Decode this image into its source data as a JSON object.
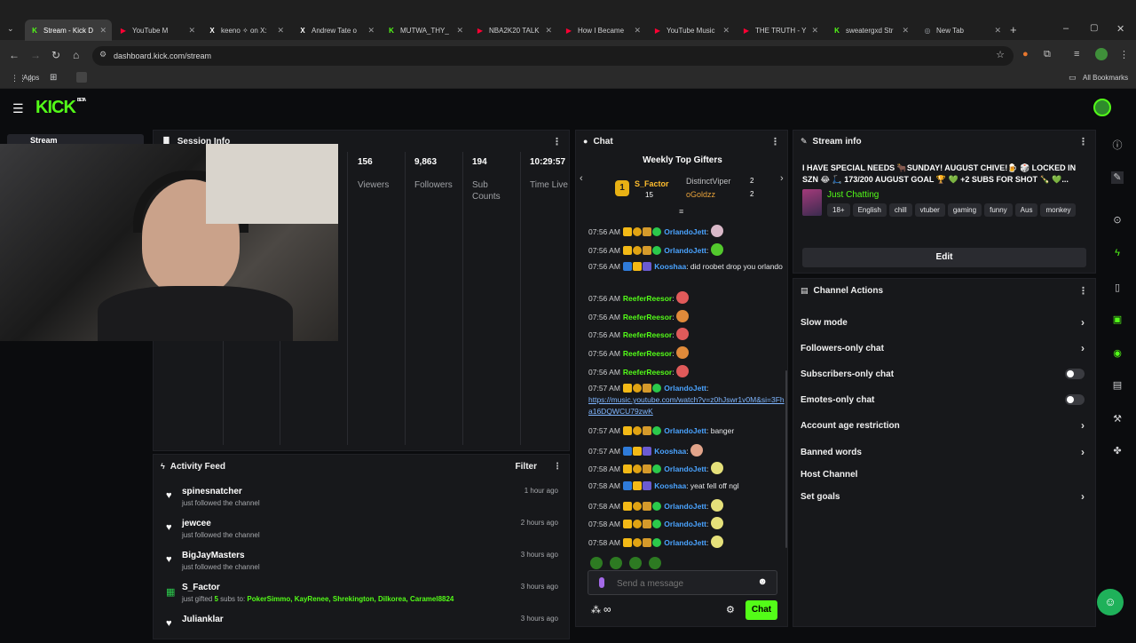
{
  "browser": {
    "tabs": [
      {
        "label": "Stream - Kick D",
        "color": "#53fc18",
        "glyph": "K"
      },
      {
        "label": "YouTube M",
        "color": "#ff0033",
        "glyph": "▶"
      },
      {
        "label": "keeno ✧ on X:",
        "color": "#ffffff",
        "glyph": "X"
      },
      {
        "label": "Andrew Tate o",
        "color": "#ffffff",
        "glyph": "X"
      },
      {
        "label": "MUTWA_THY_",
        "color": "#53fc18",
        "glyph": "K"
      },
      {
        "label": "NBA2K20 TALK",
        "color": "#ff0033",
        "glyph": "▶"
      },
      {
        "label": "How I Became",
        "color": "#ff0033",
        "glyph": "▶"
      },
      {
        "label": "YouTube Music",
        "color": "#ff0033",
        "glyph": "▶"
      },
      {
        "label": "THE TRUTH - Y",
        "color": "#ff0033",
        "glyph": "▶"
      },
      {
        "label": "sweatergxd Str",
        "color": "#53fc18",
        "glyph": "K"
      },
      {
        "label": "New Tab",
        "color": "#9aa0a6",
        "glyph": "◎"
      }
    ],
    "url": "dashboard.kick.com/stream",
    "bookmarks": {
      "apps": "Apps",
      "all": "All Bookmarks"
    }
  },
  "kick": {
    "logo": "KICK",
    "logo_beta": "BETA",
    "nav_stream": "Stream",
    "session": {
      "title": "Session Info",
      "stats": [
        {
          "value": "156",
          "label": "Viewers"
        },
        {
          "value": "9,863",
          "label": "Followers"
        },
        {
          "value": "194",
          "label": "Sub Counts"
        },
        {
          "value": "10:29:57",
          "label": "Time Live"
        }
      ]
    },
    "activity": {
      "title": "Activity Feed",
      "filter": "Filter",
      "items": [
        {
          "name": "spinesnatcher",
          "sub": "just followed the channel",
          "time": "1 hour ago",
          "icon": "heart"
        },
        {
          "name": "jewcee",
          "sub": "just followed the channel",
          "time": "2 hours ago",
          "icon": "heart"
        },
        {
          "name": "BigJayMasters",
          "sub": "just followed the channel",
          "time": "3 hours ago",
          "icon": "heart"
        },
        {
          "name": "S_Factor",
          "sub_prefix": "just gifted ",
          "sub_count": "5",
          "sub_mid": " subs to: ",
          "sub_names": "PokerSimmo, KayRenee, Shrekington, Dilkorea, Caramel8824",
          "time": "3 hours ago",
          "icon": "gift"
        },
        {
          "name": "Julianklar",
          "sub": "",
          "time": "3 hours ago",
          "icon": "heart"
        }
      ]
    },
    "chat": {
      "title": "Chat",
      "gifters_title": "Weekly Top Gifters",
      "gifters": [
        {
          "rank": "1",
          "name": "S_Factor",
          "count": "15"
        },
        {
          "name": "DistinctViper",
          "count": "2"
        },
        {
          "name": "oGoldzz",
          "count": "2"
        }
      ],
      "messages": [
        {
          "time": "07:56 AM",
          "user": "OrlandoJett",
          "color": "blue",
          "text": ":"
        },
        {
          "time": "07:56 AM",
          "user": "OrlandoJett",
          "color": "blue",
          "text": ":"
        },
        {
          "time": "07:56 AM",
          "user": "Kooshaa",
          "color": "blue",
          "text": ": did roobet drop you orlando"
        },
        {
          "time": "07:56 AM",
          "user": "ReeferReesor",
          "color": "green",
          "text": ":"
        },
        {
          "time": "07:56 AM",
          "user": "ReeferReesor",
          "color": "green",
          "text": ":"
        },
        {
          "time": "07:56 AM",
          "user": "ReeferReesor",
          "color": "green",
          "text": ":"
        },
        {
          "time": "07:56 AM",
          "user": "ReeferReesor",
          "color": "green",
          "text": ":"
        },
        {
          "time": "07:56 AM",
          "user": "ReeferReesor",
          "color": "green",
          "text": ":"
        },
        {
          "time": "07:57 AM",
          "user": "OrlandoJett",
          "color": "blue",
          "text": ":",
          "link": "https://music.youtube.com/watch?v=z0hJswr1v0M&si=3Fha16DQWCU79zwK"
        },
        {
          "time": "07:57 AM",
          "user": "OrlandoJett",
          "color": "blue",
          "text": ": banger"
        },
        {
          "time": "07:57 AM",
          "user": "Kooshaa",
          "color": "blue",
          "text": ":"
        },
        {
          "time": "07:58 AM",
          "user": "OrlandoJett",
          "color": "blue",
          "text": ":"
        },
        {
          "time": "07:58 AM",
          "user": "Kooshaa",
          "color": "blue",
          "text": ": yeat fell off ngl"
        },
        {
          "time": "07:58 AM",
          "user": "OrlandoJett",
          "color": "blue",
          "text": ":"
        },
        {
          "time": "07:58 AM",
          "user": "OrlandoJett",
          "color": "blue",
          "text": ":"
        },
        {
          "time": "07:58 AM",
          "user": "OrlandoJett",
          "color": "blue",
          "text": ":"
        }
      ],
      "input_placeholder": "Send a message",
      "send_label": "Chat"
    },
    "stream_info": {
      "title": "Stream info",
      "stream_title": "I HAVE SPECIAL NEEDS 🐂SUNDAY! AUGUST CHIVE!🍺 🎲 LOCKED IN SZN 😂 🛴 173/200 AUGUST GOAL 🏆 💚 +2 SUBS FOR SHOT 🍾 💚...",
      "category": "Just Chatting",
      "tags": [
        "18+",
        "English",
        "chill",
        "vtuber",
        "gaming",
        "funny",
        "Aus",
        "monkey"
      ],
      "edit_label": "Edit"
    },
    "channel_actions": {
      "title": "Channel Actions",
      "items": [
        {
          "label": "Slow mode",
          "control": "chevron"
        },
        {
          "label": "Followers-only chat",
          "control": "chevron"
        },
        {
          "label": "Subscribers-only chat",
          "control": "toggle"
        },
        {
          "label": "Emotes-only chat",
          "control": "toggle"
        },
        {
          "label": "Account age restriction",
          "control": "chevron"
        },
        {
          "label": "Banned words",
          "control": "chevron"
        },
        {
          "label": "Host Channel",
          "control": "none"
        },
        {
          "label": "Set goals",
          "control": "chevron"
        }
      ]
    },
    "accent": "#53fc18"
  }
}
